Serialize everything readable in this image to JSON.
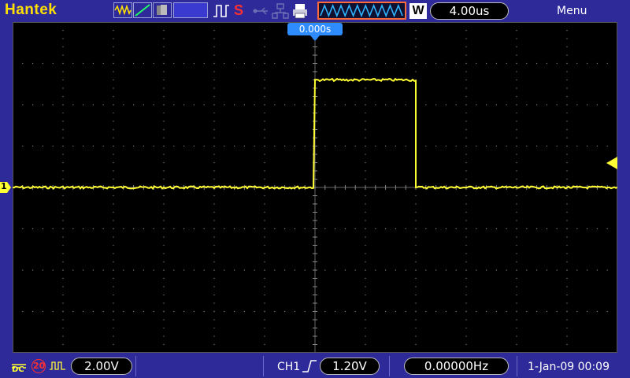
{
  "brand": "Hantek",
  "top": {
    "timebase": "4.00us",
    "window_mode": "W",
    "menu": "Menu",
    "trigger_position": "0.000s",
    "icons": [
      "waveform-icon",
      "ramp-icon",
      "persistence-icon",
      "blank-field",
      "trigger-edge-icon",
      "dollar-s-icon",
      "usb-icon",
      "network-icon",
      "printer-icon"
    ]
  },
  "channel": {
    "marker": "1",
    "coupling": "DC",
    "bw_limit": "20",
    "volts_per_div": "2.00V"
  },
  "trigger": {
    "source": "CH1",
    "level": "1.20V",
    "frequency": "0.00000Hz"
  },
  "datetime": "1-Jan-09 00:09",
  "trace": {
    "color": "#ffff33",
    "baseline_div": 0,
    "high_level_div": 2.6,
    "pulse_start_div": 0,
    "pulse_end_div": 2
  },
  "colors": {
    "background": "#2e2a9a",
    "screen": "#000000",
    "brand": "#ffe000",
    "trigger_badge": "#2f8cff",
    "window_border": "#ff6a3a"
  }
}
